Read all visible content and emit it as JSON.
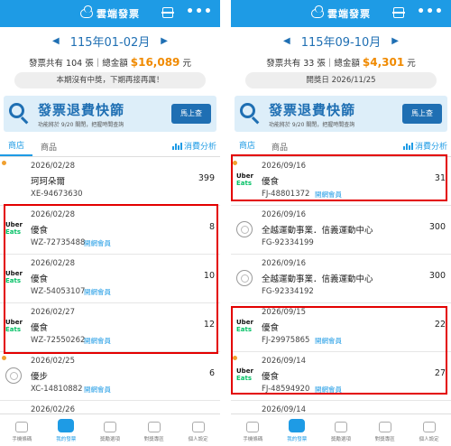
{
  "app_title": "雲端發票",
  "left": {
    "period": "115年01-02月",
    "summary_prefix": "發票共有 104 張｜總金額",
    "summary_amount": "$16,089",
    "summary_suffix": "元",
    "notice": "本期沒有中獎，下期再接再厲！",
    "banner_title": "發票退費快篩",
    "banner_sub": "功能將於 9/20 關閉，把握時間查詢",
    "banner_btn": "馬上查",
    "tab_store": "商店",
    "tab_product": "商品",
    "analysis": "消費分析",
    "rows": [
      {
        "date": "2026/02/28",
        "store": "珂珂朵爾",
        "amount": "399",
        "num": "XE-94673630",
        "member": "",
        "logo": "none"
      },
      {
        "date": "2026/02/28",
        "store": "優食",
        "amount": "8",
        "num": "WZ-72735488",
        "member": "開網會員",
        "logo": "uber"
      },
      {
        "date": "2026/02/28",
        "store": "優食",
        "amount": "10",
        "num": "WZ-54053107",
        "member": "開網會員",
        "logo": "uber"
      },
      {
        "date": "2026/02/27",
        "store": "優食",
        "amount": "12",
        "num": "WZ-72550262",
        "member": "開網會員",
        "logo": "uber"
      },
      {
        "date": "2026/02/25",
        "store": "優步",
        "amount": "6",
        "num": "XC-14810882",
        "member": "開網會員",
        "logo": "circle"
      },
      {
        "date": "2026/02/26",
        "store": "",
        "amount": "",
        "num": "",
        "member": "",
        "logo": "none"
      }
    ]
  },
  "right": {
    "period": "115年09-10月",
    "summary_prefix": "發票共有 33 張｜總金額",
    "summary_amount": "$4,301",
    "summary_suffix": "元",
    "notice": "開獎日 2026/11/25",
    "banner_title": "發票退費快篩",
    "banner_sub": "功能將於 9/20 關閉，把握時間查詢",
    "banner_btn": "馬上查",
    "tab_store": "商店",
    "tab_product": "商品",
    "analysis": "消費分析",
    "rows": [
      {
        "date": "2026/09/16",
        "store": "優食",
        "amount": "31",
        "num": "FJ-48801372",
        "member": "開網會員",
        "logo": "uber"
      },
      {
        "date": "2026/09/16",
        "store": "全越運動事業．信義運動中心",
        "amount": "300",
        "num": "FG-92334199",
        "member": "",
        "logo": "circle"
      },
      {
        "date": "2026/09/16",
        "store": "全越運動事業．信義運動中心",
        "amount": "300",
        "num": "FG-92334192",
        "member": "",
        "logo": "circle"
      },
      {
        "date": "2026/09/15",
        "store": "優食",
        "amount": "22",
        "num": "FJ-29975865",
        "member": "開網會員",
        "logo": "uber"
      },
      {
        "date": "2026/09/14",
        "store": "優食",
        "amount": "27",
        "num": "FJ-48594920",
        "member": "開網會員",
        "logo": "uber"
      },
      {
        "date": "2026/09/14",
        "store": "",
        "amount": "",
        "num": "",
        "member": "",
        "logo": "none"
      }
    ]
  },
  "uber_top": "Uber",
  "uber_bottom": "Eats",
  "nav": [
    "手機條碼",
    "我的發票",
    "獎勵選項",
    "對獎專區",
    "個人設定"
  ],
  "nav_right": [
    "手機條碼",
    "我的發票",
    "獎勵選項",
    "對獎專區",
    "個人設定"
  ],
  "colors": {
    "header": "#1e9be5",
    "accent": "#f08a00",
    "highlight": "#e30000",
    "link": "#1e9be5"
  }
}
